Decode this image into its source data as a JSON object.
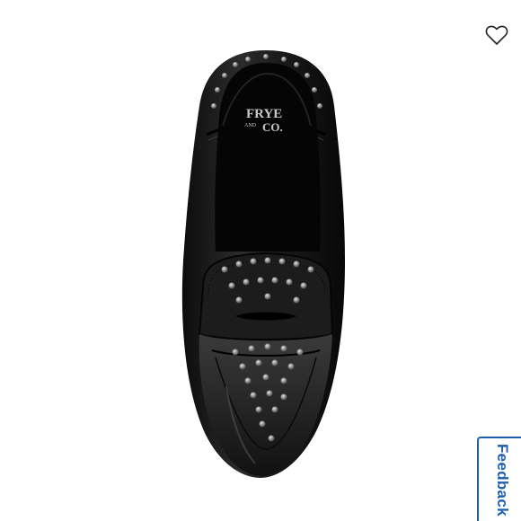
{
  "product": {
    "brand_mark_top": "FRYE",
    "brand_mark_mid": "AND",
    "brand_mark_bottom": "CO.",
    "image_alt": "Black leather studded penny loafer, top view",
    "shoe_color": "#151515"
  },
  "wishlist": {
    "icon": "heart-outline-icon"
  },
  "feedback": {
    "label": "Feedback",
    "color": "#1f5fae"
  }
}
